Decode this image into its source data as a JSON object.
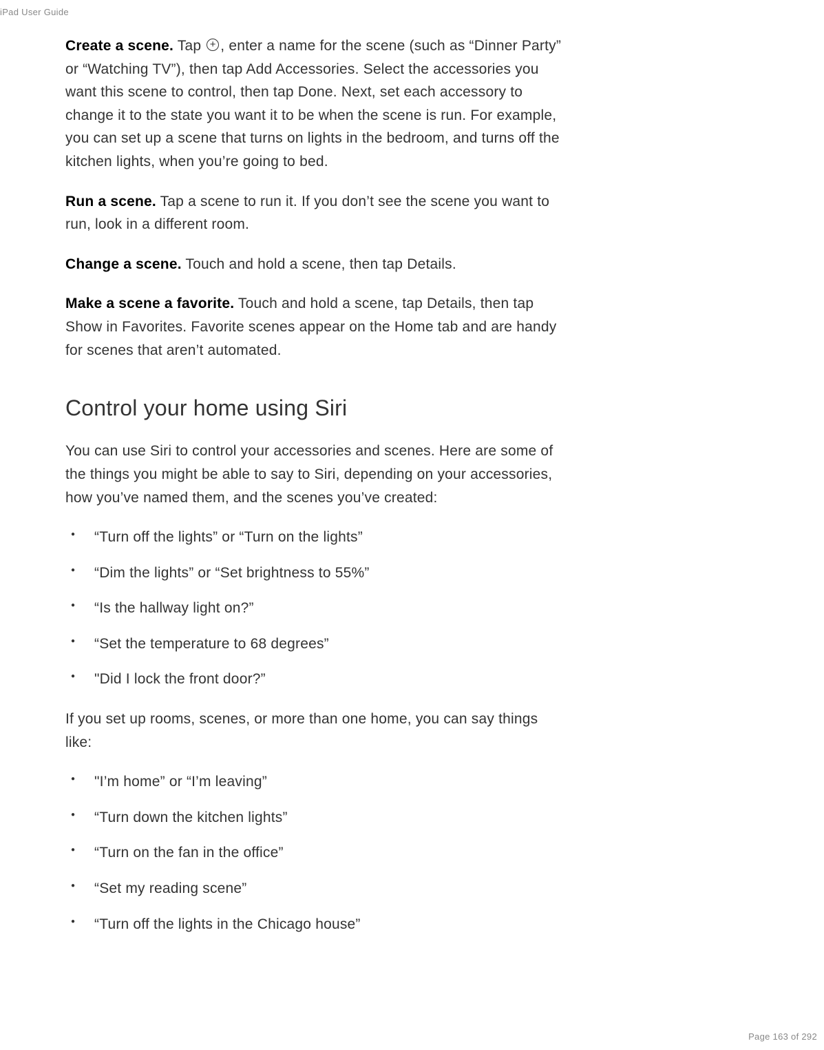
{
  "header": {
    "title": "iPad User Guide"
  },
  "paragraphs": {
    "p1_lead": "Create a scene.",
    "p1_text_before_icon": " Tap ",
    "p1_text_after_icon": ", enter a name for the scene (such as “Dinner Party” or “Watching TV”), then tap Add Accessories. Select the accessories you want this scene to control, then tap Done. Next, set each accessory to change it to the state you want it to be when the scene is run. For example, you can set up a scene that turns on lights in the bedroom, and turns off the kitchen lights, when you’re going to bed.",
    "p2_lead": "Run a scene.",
    "p2_text": " Tap a scene to run it. If you don’t see the scene you want to run, look in a different room.",
    "p3_lead": "Change a scene.",
    "p3_text": " Touch and hold a scene, then tap Details.",
    "p4_lead": "Make a scene a favorite.",
    "p4_text": " Touch and hold a scene, tap Details, then tap Show in Favorites. Favorite scenes appear on the Home tab and are handy for scenes that aren’t automated."
  },
  "heading": "Control your home using Siri",
  "intro_text": "You can use Siri to control your accessories and scenes. Here are some of the things you might be able to say to Siri, depending on your accessories, how you’ve named them, and the scenes you’ve created:",
  "list1": {
    "item0": "“Turn off the lights” or “Turn on the lights”",
    "item1": "“Dim the lights” or “Set brightness to 55%”",
    "item2": "“Is the hallway light on?”",
    "item3": "“Set the temperature to 68 degrees”",
    "item4": "\"Did I lock the front door?”"
  },
  "middle_text": "If you set up rooms, scenes, or more than one home, you can say things like:",
  "list2": {
    "item0": "\"I’m home” or “I’m leaving”",
    "item1": "“Turn down the kitchen lights”",
    "item2": "“Turn on the fan in the office”",
    "item3": "“Set my reading scene”",
    "item4": "“Turn off the lights in the Chicago house”"
  },
  "footer": {
    "page_text": "Page 163 of 292"
  }
}
